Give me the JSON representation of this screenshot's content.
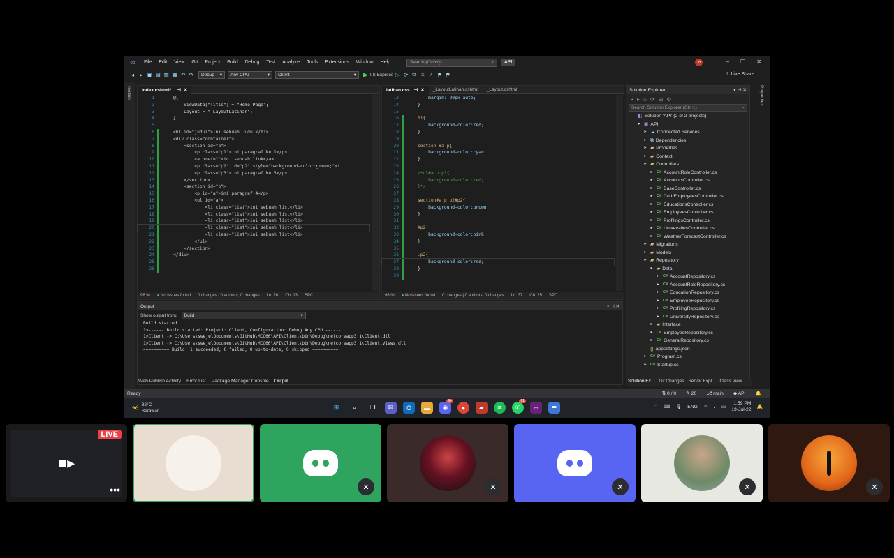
{
  "menu": {
    "items": [
      "File",
      "Edit",
      "View",
      "Git",
      "Project",
      "Build",
      "Debug",
      "Test",
      "Analyze",
      "Tools",
      "Extensions",
      "Window",
      "Help"
    ],
    "search_placeholder": "Search (Ctrl+Q)",
    "solution_badge": "API",
    "avatar_initials": "JH"
  },
  "toolbar": {
    "config": "Debug",
    "platform": "Any CPU",
    "startup": "Client",
    "run_label": "IIS Express",
    "live_share": "Live Share"
  },
  "side": {
    "left": "Toolbox",
    "right": "Properties"
  },
  "left_editor": {
    "tabs": [
      "Index.cshtml*"
    ],
    "lines": [
      {
        "n": "1",
        "t": "@{"
      },
      {
        "n": "2",
        "t": "    ViewData[\"Title\"] = \"Home Page\";"
      },
      {
        "n": "3",
        "t": "    Layout = \"_LayoutLatihan\";"
      },
      {
        "n": "4",
        "t": "}"
      },
      {
        "n": "5",
        "t": ""
      },
      {
        "n": "6",
        "t": "<h1 id=\"judul\">Ini sebuah Judul</h1>"
      },
      {
        "n": "7",
        "t": "<div class=\"container\">"
      },
      {
        "n": "8",
        "t": "    <section id=\"a\">"
      },
      {
        "n": "9",
        "t": "        <p class=\"p1\">ini paragraf ke 1</p>"
      },
      {
        "n": "10",
        "t": "        <a href=\"\">ini sebuah link</a>"
      },
      {
        "n": "11",
        "t": "        <p class=\"p2\" id=\"p2\" style=\"background-color:green;\">i"
      },
      {
        "n": "12",
        "t": "        <p class=\"p3\">ini paragraf ke 3</p>"
      },
      {
        "n": "13",
        "t": "    </section>"
      },
      {
        "n": "14",
        "t": "    <section id=\"b\">"
      },
      {
        "n": "15",
        "t": "        <p id=\"a\">ini paragraf 4</p>"
      },
      {
        "n": "16",
        "t": "        <ul id=\"a\">"
      },
      {
        "n": "17",
        "t": "            <li class=\"list\">ini sebuah list</li>"
      },
      {
        "n": "18",
        "t": "            <li class=\"list\">ini sebuah list</li>"
      },
      {
        "n": "19",
        "t": "            <li class=\"list\">ini sebuah list</li>"
      },
      {
        "n": "20",
        "t": "            <li class=\"list\">ini sebuah list</li>"
      },
      {
        "n": "21",
        "t": "            <li class=\"list\">ini sebuah list</li>"
      },
      {
        "n": "22",
        "t": "        </ul>"
      },
      {
        "n": "23",
        "t": "    </section>"
      },
      {
        "n": "24",
        "t": "</div>"
      },
      {
        "n": "25",
        "t": ""
      },
      {
        "n": "26",
        "t": ""
      }
    ],
    "status": {
      "zoom": "96 %",
      "issues": "No issues found",
      "changes": "0 changes | 0 authors, 0 changes",
      "ln": "Ln: 20",
      "ch": "Ch: 13",
      "mode": "SPC"
    }
  },
  "right_editor": {
    "tabs": [
      "latihan.css",
      "_LayoutLatihan.cshtml",
      "_Layout.cshtml"
    ],
    "lines": [
      {
        "n": "13",
        "t": "    margin: 20px auto;"
      },
      {
        "n": "14",
        "t": "}"
      },
      {
        "n": "15",
        "t": ""
      },
      {
        "n": "16",
        "t": "h1{"
      },
      {
        "n": "17",
        "t": "    background-color:red;"
      },
      {
        "n": "18",
        "t": "}"
      },
      {
        "n": "19",
        "t": ""
      },
      {
        "n": "20",
        "t": "section #a p{"
      },
      {
        "n": "21",
        "t": "    background-color:cyan;"
      },
      {
        "n": "22",
        "t": "}"
      },
      {
        "n": "23",
        "t": ""
      },
      {
        "n": "24",
        "t": "/*ul#a p.p1{"
      },
      {
        "n": "25",
        "t": "    background-color:red;"
      },
      {
        "n": "26",
        "t": "}*/"
      },
      {
        "n": "27",
        "t": ""
      },
      {
        "n": "28",
        "t": "section#a p.p2#p2{"
      },
      {
        "n": "29",
        "t": "    background-color:brown;"
      },
      {
        "n": "30",
        "t": "}"
      },
      {
        "n": "31",
        "t": ""
      },
      {
        "n": "32",
        "t": "#p2{"
      },
      {
        "n": "33",
        "t": "    background-color:pink;"
      },
      {
        "n": "34",
        "t": "}"
      },
      {
        "n": "35",
        "t": ""
      },
      {
        "n": "36",
        "t": ".p2{"
      },
      {
        "n": "37",
        "t": "    background-color:red;"
      },
      {
        "n": "38",
        "t": "}"
      },
      {
        "n": "39",
        "t": ""
      }
    ],
    "status": {
      "zoom": "96 %",
      "issues": "No issues found",
      "changes": "0 changes | 0 authors, 0 changes",
      "ln": "Ln: 37",
      "ch": "Ch: 25",
      "mode": "SPC"
    }
  },
  "output": {
    "title": "Output",
    "show_from_label": "Show output from:",
    "show_from_value": "Build",
    "lines": [
      "Build started...",
      "1>------ Build started: Project: Client, Configuration: Debug Any CPU ------",
      "1>Client -> C:\\Users\\sweje\\Documents\\GitHub\\MCC66\\API\\Client\\bin\\Debug\\netcoreapp3.1\\Client.dll",
      "1>Client -> C:\\Users\\sweje\\Documents\\GitHub\\MCC66\\API\\Client\\bin\\Debug\\netcoreapp3.1\\Client.Views.dll",
      "========== Build: 1 succeeded, 0 failed, 0 up-to-date, 0 skipped =========="
    ]
  },
  "bottom_tabs": [
    "Web Publish Activity",
    "Error List",
    "Package Manager Console",
    "Output"
  ],
  "solution": {
    "title": "Solution Explorer",
    "search_placeholder": "Search Solution Explorer (Ctrl+;)",
    "items": [
      {
        "label": "Solution 'API' (2 of 2 projects)",
        "indent": 0,
        "kind": "sln"
      },
      {
        "label": "API",
        "indent": 1,
        "kind": "proj"
      },
      {
        "label": "Connected Services",
        "indent": 2,
        "kind": "svc"
      },
      {
        "label": "Dependencies",
        "indent": 2,
        "kind": "dep"
      },
      {
        "label": "Properties",
        "indent": 2,
        "kind": "folder"
      },
      {
        "label": "Context",
        "indent": 2,
        "kind": "folder"
      },
      {
        "label": "Controllers",
        "indent": 2,
        "kind": "folder"
      },
      {
        "label": "AccountRoleController.cs",
        "indent": 3,
        "kind": "cs"
      },
      {
        "label": "AccountsController.cs",
        "indent": 3,
        "kind": "cs"
      },
      {
        "label": "BaseController.cs",
        "indent": 3,
        "kind": "cs"
      },
      {
        "label": "CnthEmployeesController.cs",
        "indent": 3,
        "kind": "cs"
      },
      {
        "label": "EducationsController.cs",
        "indent": 3,
        "kind": "cs"
      },
      {
        "label": "EmployeesController.cs",
        "indent": 3,
        "kind": "cs"
      },
      {
        "label": "ProfilingsController.cs",
        "indent": 3,
        "kind": "cs"
      },
      {
        "label": "UniversitiesController.cs",
        "indent": 3,
        "kind": "cs"
      },
      {
        "label": "WeatherForecastController.cs",
        "indent": 3,
        "kind": "cs"
      },
      {
        "label": "Migrations",
        "indent": 2,
        "kind": "folder"
      },
      {
        "label": "Models",
        "indent": 2,
        "kind": "folder"
      },
      {
        "label": "Repository",
        "indent": 2,
        "kind": "folder"
      },
      {
        "label": "Data",
        "indent": 3,
        "kind": "folder"
      },
      {
        "label": "AccountRepository.cs",
        "indent": 4,
        "kind": "cs"
      },
      {
        "label": "AccountRoleRepository.cs",
        "indent": 4,
        "kind": "cs"
      },
      {
        "label": "EducationRepository.cs",
        "indent": 4,
        "kind": "cs"
      },
      {
        "label": "EmployeeRepository.cs",
        "indent": 4,
        "kind": "cs"
      },
      {
        "label": "ProfilingRepository.cs",
        "indent": 4,
        "kind": "cs"
      },
      {
        "label": "UniversityRepository.cs",
        "indent": 4,
        "kind": "cs"
      },
      {
        "label": "Interface",
        "indent": 3,
        "kind": "folder"
      },
      {
        "label": "EmployeeRepository.cs",
        "indent": 3,
        "kind": "cs"
      },
      {
        "label": "GeneralRepository.cs",
        "indent": 3,
        "kind": "cs"
      },
      {
        "label": "appsettings.json",
        "indent": 2,
        "kind": "json"
      },
      {
        "label": "Program.cs",
        "indent": 2,
        "kind": "cs"
      },
      {
        "label": "Startup.cs",
        "indent": 2,
        "kind": "cs"
      }
    ],
    "tabs": [
      "Solution Ex...",
      "Git Changes",
      "Server Expl...",
      "Class View"
    ]
  },
  "statusbar": {
    "ready": "Ready",
    "sync": "0 / 0",
    "edits": "20",
    "branch": "main",
    "repo": "API"
  },
  "taskbar": {
    "temp": "32°C",
    "weather": "Berawan",
    "lang": "ENG",
    "time": "1:59 PM",
    "date": "19-Jul-22",
    "badges": {
      "discord": "9+",
      "whatsapp": "61"
    }
  },
  "call": {
    "live_label": "LIVE"
  },
  "colors": {
    "accent": "#5a9bd8",
    "discord": "#5865f2",
    "green_tile": "#2ea45f",
    "live": "#ed4245"
  }
}
